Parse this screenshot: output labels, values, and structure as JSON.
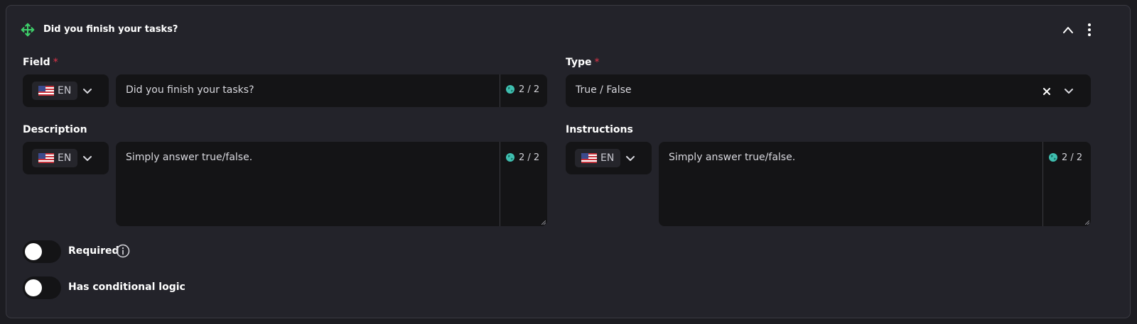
{
  "header": {
    "title": "Did you finish your tasks?",
    "move_icon": "move-icon",
    "collapse_icon": "chevron-up-icon",
    "menu_icon": "kebab-menu-icon"
  },
  "field": {
    "label": "Field",
    "required_mark": "*",
    "lang": "EN",
    "value": "Did you finish your tasks?",
    "counter": "2 / 2"
  },
  "type": {
    "label": "Type",
    "required_mark": "*",
    "value": "True / False"
  },
  "description": {
    "label": "Description",
    "lang": "EN",
    "value": "Simply answer true/false.",
    "counter": "2 / 2"
  },
  "instructions": {
    "label": "Instructions",
    "lang": "EN",
    "value": "Simply answer true/false.",
    "counter": "2 / 2"
  },
  "toggles": {
    "required_label": "Required",
    "required_on": false,
    "conditional_label": "Has conditional logic",
    "conditional_on": false
  },
  "colors": {
    "accent_green": "#3ecf6a",
    "required_red": "#e0354a",
    "globe_teal": "#3fbfb0"
  }
}
